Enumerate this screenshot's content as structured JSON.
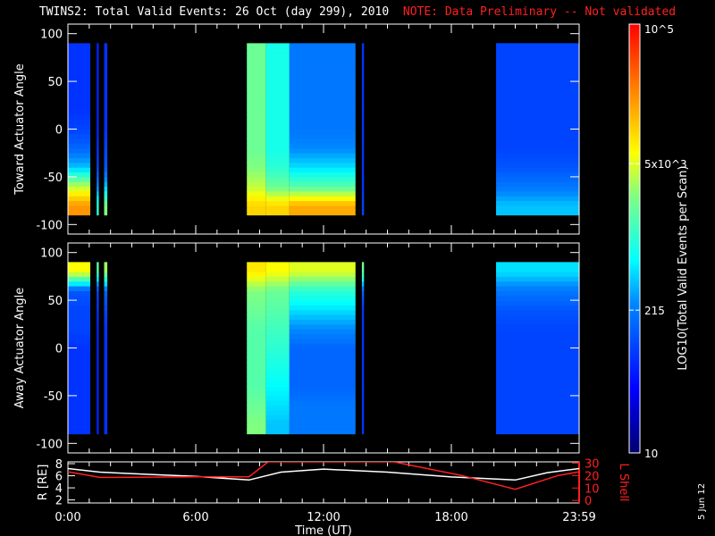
{
  "title": {
    "main": "TWINS2: Total Valid Events: 26 Oct (day 299), 2010",
    "note": "NOTE: Data Preliminary -- Not validated"
  },
  "footer_date": "5 Jun 12",
  "colors": {
    "note": "#ff2020",
    "r_line": "#ffffff",
    "l_line": "#ff2020"
  },
  "chart_data": [
    {
      "type": "heatmap",
      "name": "toward",
      "ylabel": "Toward Actuator Angle",
      "ylim": [
        -110,
        110
      ],
      "yticks": [
        100,
        50,
        0,
        -50,
        -100
      ],
      "xlim": [
        0,
        24
      ],
      "angle_bins": [
        -80,
        -60,
        -40,
        -20,
        0,
        20,
        40,
        60,
        80
      ],
      "segments": [
        {
          "t": [
            0.0,
            1.05
          ],
          "log_values": [
            4.3,
            3.6,
            2.6,
            2.2,
            2.0,
            1.9,
            1.9,
            1.9,
            1.9
          ]
        },
        {
          "t": [
            1.35,
            1.45
          ],
          "log_values": [
            3.0,
            2.4,
            2.0,
            1.9,
            1.8,
            1.8,
            1.8,
            1.8,
            1.8
          ]
        },
        {
          "t": [
            1.7,
            1.85
          ],
          "log_values": [
            3.4,
            2.6,
            2.1,
            2.0,
            1.9,
            1.9,
            1.9,
            1.9,
            1.9
          ]
        },
        {
          "t": [
            8.4,
            9.3
          ],
          "log_values": [
            4.0,
            3.6,
            3.4,
            3.3,
            3.3,
            3.3,
            3.3,
            3.3,
            3.3
          ]
        },
        {
          "t": [
            9.3,
            10.4
          ],
          "log_values": [
            4.0,
            3.3,
            3.0,
            2.9,
            2.9,
            2.9,
            2.9,
            2.9,
            2.9
          ]
        },
        {
          "t": [
            10.4,
            13.5
          ],
          "log_values": [
            4.2,
            3.2,
            2.7,
            2.4,
            2.3,
            2.3,
            2.3,
            2.3,
            2.3
          ]
        },
        {
          "t": [
            13.8,
            13.9
          ],
          "log_values": [
            2.0,
            1.9,
            1.9,
            1.9,
            1.9,
            1.9,
            1.9,
            1.9,
            1.9
          ]
        },
        {
          "t": [
            20.1,
            24.0
          ],
          "log_values": [
            2.6,
            2.3,
            2.1,
            2.0,
            2.0,
            2.0,
            2.0,
            2.0,
            2.0
          ]
        }
      ]
    },
    {
      "type": "heatmap",
      "name": "away",
      "ylabel": "Away Actuator Angle",
      "ylim": [
        -110,
        110
      ],
      "yticks": [
        100,
        50,
        0,
        -50,
        -100
      ],
      "xlim": [
        0,
        24
      ],
      "angle_bins": [
        -80,
        -60,
        -40,
        -20,
        0,
        20,
        40,
        60,
        80
      ],
      "segments": [
        {
          "t": [
            0.0,
            1.05
          ],
          "log_values": [
            1.9,
            1.9,
            1.9,
            1.9,
            1.9,
            2.0,
            2.0,
            2.1,
            3.8
          ]
        },
        {
          "t": [
            1.35,
            1.45
          ],
          "log_values": [
            1.8,
            1.8,
            1.8,
            1.8,
            1.8,
            1.8,
            1.9,
            2.0,
            3.2
          ]
        },
        {
          "t": [
            1.7,
            1.85
          ],
          "log_values": [
            1.9,
            1.9,
            1.9,
            1.9,
            1.9,
            1.9,
            2.0,
            2.2,
            3.5
          ]
        },
        {
          "t": [
            8.4,
            9.3
          ],
          "log_values": [
            3.4,
            3.3,
            3.2,
            3.2,
            3.2,
            3.2,
            3.3,
            3.4,
            3.9
          ]
        },
        {
          "t": [
            9.3,
            10.4
          ],
          "log_values": [
            2.6,
            2.7,
            2.8,
            2.9,
            3.0,
            3.1,
            3.2,
            3.3,
            3.8
          ]
        },
        {
          "t": [
            10.4,
            13.5
          ],
          "log_values": [
            2.3,
            2.3,
            2.2,
            2.2,
            2.2,
            2.4,
            2.7,
            3.0,
            3.7
          ]
        },
        {
          "t": [
            13.8,
            13.9
          ],
          "log_values": [
            1.9,
            1.9,
            1.9,
            1.9,
            1.9,
            1.9,
            1.9,
            2.2,
            3.3
          ]
        },
        {
          "t": [
            20.1,
            24.0
          ],
          "log_values": [
            2.0,
            2.0,
            2.0,
            2.0,
            2.0,
            2.0,
            2.1,
            2.3,
            2.7
          ]
        }
      ]
    },
    {
      "type": "line",
      "name": "orbit",
      "xlabel": "Time (UT)",
      "xticks": [
        0,
        6,
        12,
        18,
        24
      ],
      "xtick_labels": [
        "0:00",
        "6:00",
        "12:00",
        "18:00",
        "23:59"
      ],
      "ylabel": "R [RE]",
      "ylim": [
        1.5,
        8.3
      ],
      "yticks": [
        8,
        6,
        4,
        2
      ],
      "y2label": "L Shell",
      "y2lim": [
        -2,
        31
      ],
      "y2ticks": [
        30,
        20,
        10,
        0
      ],
      "series": [
        {
          "name": "R",
          "axis": "left",
          "x": [
            0,
            1.5,
            4,
            6,
            8.5,
            10,
            12,
            15,
            18,
            21,
            22.5,
            24
          ],
          "y": [
            7.2,
            6.6,
            6.2,
            5.9,
            5.3,
            6.6,
            7.1,
            6.6,
            5.8,
            5.3,
            6.5,
            7.2
          ]
        },
        {
          "name": "L Shell",
          "axis": "right",
          "x": [
            0,
            1.5,
            6,
            8.5,
            9.4,
            15.3,
            18.5,
            21,
            23,
            24
          ],
          "y": [
            23,
            18.5,
            19,
            19,
            31,
            31,
            20,
            9,
            20,
            23
          ]
        }
      ]
    }
  ],
  "colorbar": {
    "label": "LOG10(Total Valid Events per Scan)",
    "range_log": [
      1,
      5
    ],
    "ticks": [
      {
        "log": 5,
        "label": "10^5"
      },
      {
        "log": 3.699,
        "label": "5x10^3"
      },
      {
        "log": 2.332,
        "label": "215"
      },
      {
        "log": 1,
        "label": "10"
      }
    ]
  }
}
